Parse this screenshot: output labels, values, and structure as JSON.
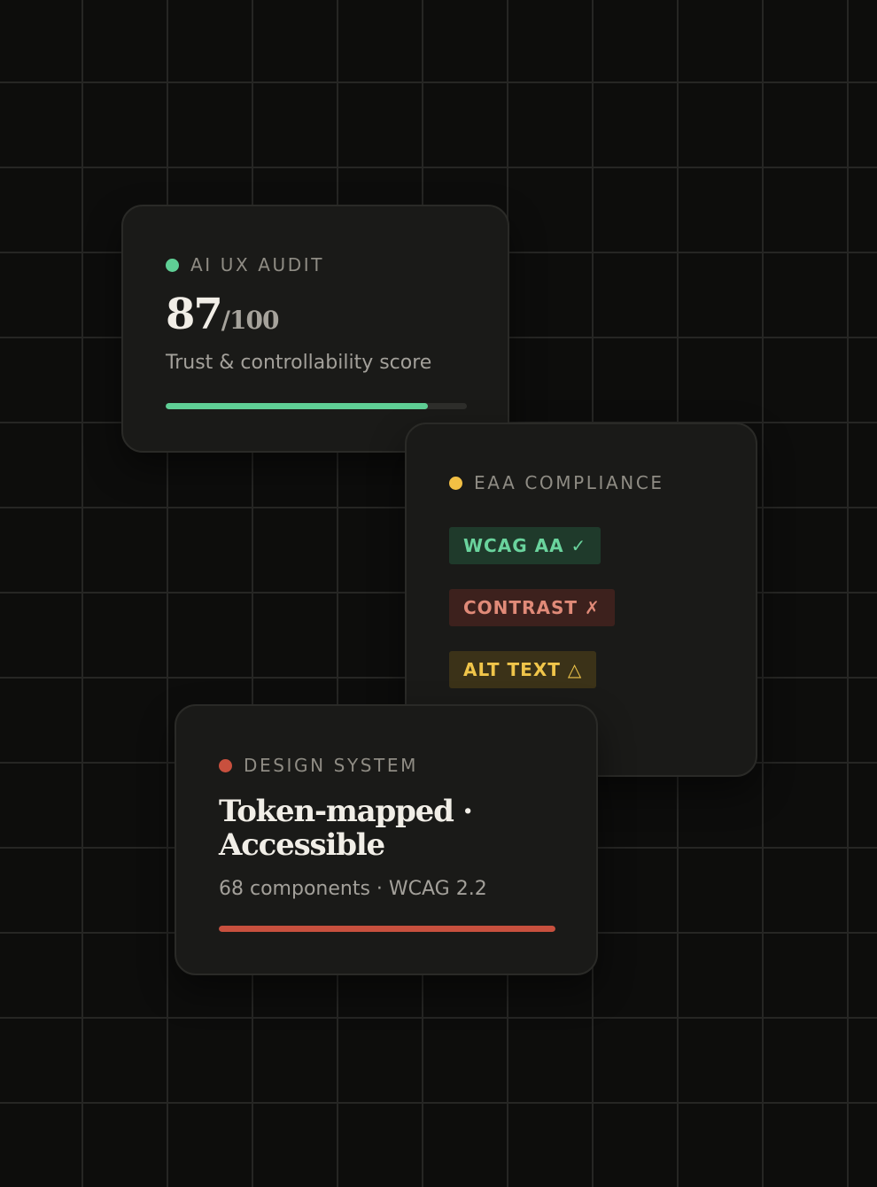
{
  "colors": {
    "background": "#0d0d0c",
    "card": "#1a1a18",
    "accent_green": "#5fcf95",
    "accent_yellow": "#f2bf44",
    "accent_red": "#c8503e",
    "track": "#2e2e2b"
  },
  "audit_card": {
    "label": "AI UX AUDIT",
    "dot_color": "#5fcf95",
    "score_value": "87",
    "score_total": "/100",
    "subtitle": "Trust & controllability score",
    "progress": 0.87,
    "progress_color": "#5fcf95"
  },
  "compliance_card": {
    "label": "EAA COMPLIANCE",
    "dot_color": "#f2bf44",
    "chips": [
      {
        "text": "WCAG AA ✓",
        "status": "pass"
      },
      {
        "text": "CONTRAST ✗",
        "status": "fail"
      },
      {
        "text": "ALT TEXT △",
        "status": "warn"
      }
    ]
  },
  "design_card": {
    "label": "DESIGN SYSTEM",
    "dot_color": "#c8503e",
    "headline": "Token-mapped · Accessible",
    "subtitle": "68 components · WCAG 2.2",
    "progress": 1.0,
    "progress_color": "#c8503e"
  }
}
